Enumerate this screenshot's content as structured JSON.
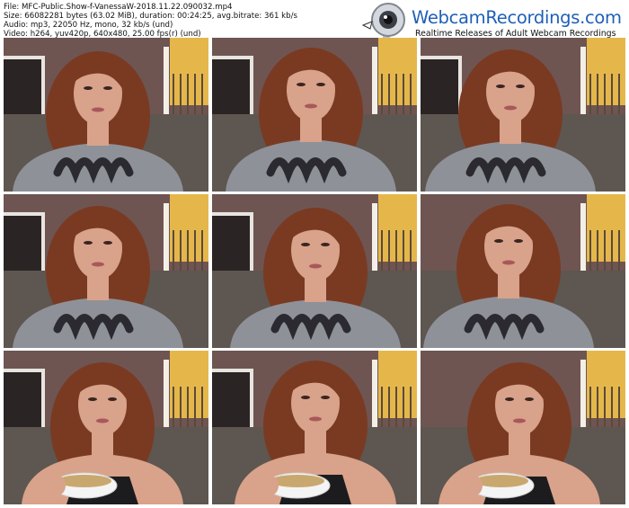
{
  "header": {
    "lines": [
      "File: MFC-Public.Show-f-VanessaW-2018.11.22.090032.mp4",
      "Size: 66082281 bytes (63.02 MiB), duration: 00:24:25, avg.bitrate: 361 kb/s",
      "Audio: mp3, 22050 Hz, mono, 32 kb/s (und)",
      "Video: h264, yuv420p, 640x480, 25.00 fps(r) (und)"
    ]
  },
  "logo": {
    "name": "WebcamRecordings.com",
    "tagline": "Realtime Releases of Adult Webcam Recordings"
  },
  "thumbnails": [
    {
      "outfit": "sweater",
      "bowl": false
    },
    {
      "outfit": "sweater",
      "bowl": false
    },
    {
      "outfit": "sweater",
      "bowl": false
    },
    {
      "outfit": "sweater",
      "bowl": false
    },
    {
      "outfit": "sweater",
      "bowl": false
    },
    {
      "outfit": "sweater",
      "bowl": false
    },
    {
      "outfit": "tank",
      "bowl": true
    },
    {
      "outfit": "tank",
      "bowl": true
    },
    {
      "outfit": "tank",
      "bowl": true
    }
  ],
  "colors": {
    "logo_blue": "#1e5fb8",
    "sweater": "#8f9198",
    "hair": "#7a3a22",
    "skin": "#d9a28a",
    "wall": "#6e5552",
    "lamp": "#f2c24a"
  }
}
